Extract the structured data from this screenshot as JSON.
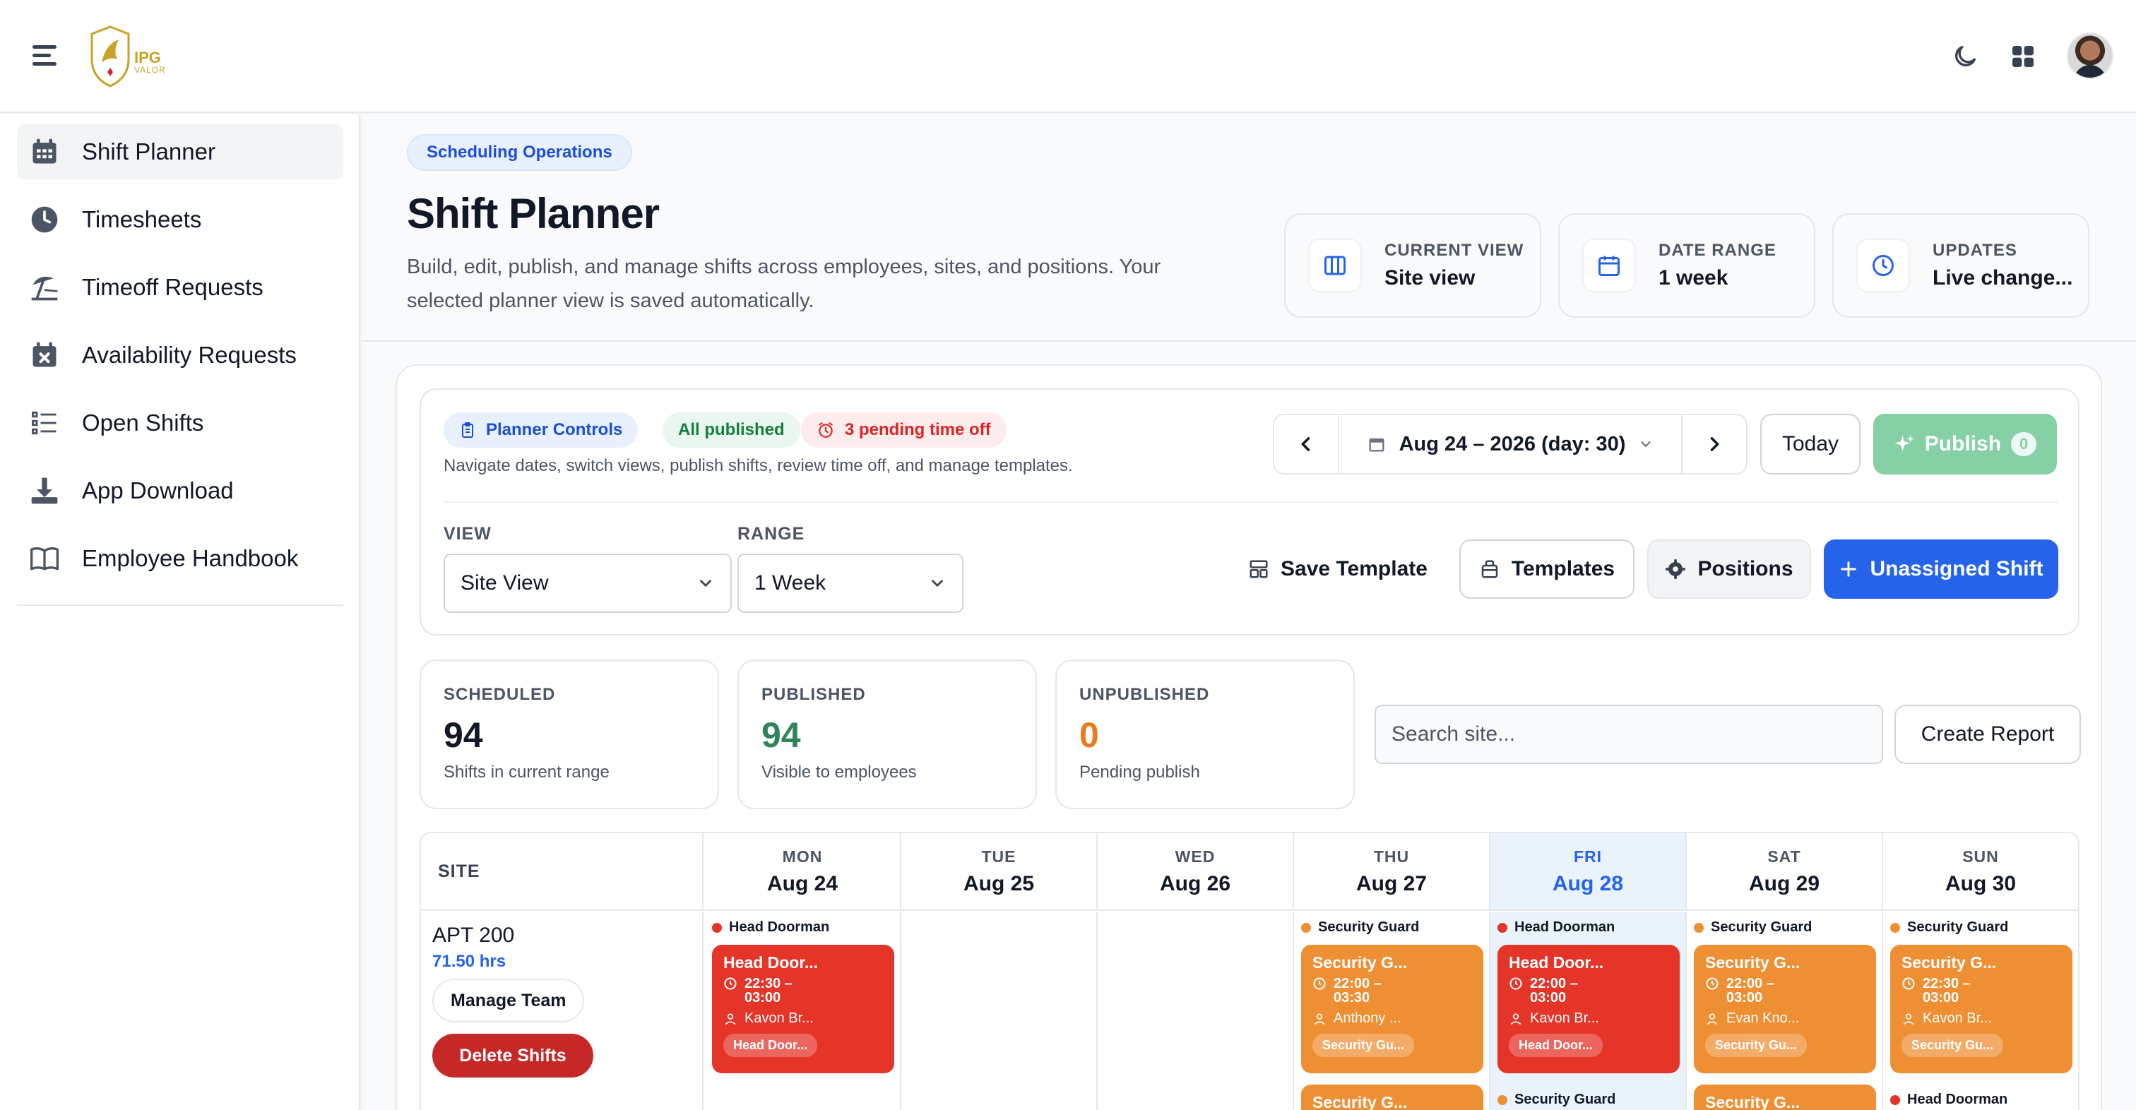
{
  "topbar": {
    "logo_text": "IPG",
    "logo_sub": "VALOR"
  },
  "sidebar": {
    "items": [
      {
        "label": "Shift Planner",
        "icon": "calendar-grid-icon",
        "active": true
      },
      {
        "label": "Timesheets",
        "icon": "clock-icon",
        "active": false
      },
      {
        "label": "Timeoff Requests",
        "icon": "beach-umbrella-icon",
        "active": false
      },
      {
        "label": "Availability Requests",
        "icon": "calendar-x-icon",
        "active": false
      },
      {
        "label": "Open Shifts",
        "icon": "list-icon",
        "active": false
      },
      {
        "label": "App Download",
        "icon": "download-icon",
        "active": false
      },
      {
        "label": "Employee Handbook",
        "icon": "book-icon",
        "active": false
      }
    ]
  },
  "header": {
    "badge": "Scheduling Operations",
    "title": "Shift Planner",
    "description": "Build, edit, publish, and manage shifts across employees, sites, and positions. Your selected planner view is saved automatically.",
    "stats": [
      {
        "key": "CURRENT VIEW",
        "value": "Site view",
        "icon": "columns-icon"
      },
      {
        "key": "DATE RANGE",
        "value": "1 week",
        "icon": "calendar-icon"
      },
      {
        "key": "UPDATES",
        "value": "Live change...",
        "icon": "clock-icon"
      }
    ]
  },
  "controls": {
    "badge_planner": "Planner Controls",
    "badge_published": "All published",
    "badge_pending": "3 pending time off",
    "hint": "Navigate dates, switch views, publish shifts, review time off, and manage templates.",
    "date_label": "Aug 24 – 2026 (day: 30)",
    "today_label": "Today",
    "publish_label": "Publish",
    "publish_count": "0",
    "view_label": "VIEW",
    "view_value": "Site View",
    "range_label": "RANGE",
    "range_value": "1 Week",
    "save_template": "Save Template",
    "templates": "Templates",
    "positions": "Positions",
    "unassigned_shift": "Unassigned Shift"
  },
  "summary": {
    "scheduled": {
      "key": "SCHEDULED",
      "value": "94",
      "sub": "Shifts in current range"
    },
    "published": {
      "key": "PUBLISHED",
      "value": "94",
      "sub": "Visible to employees"
    },
    "unpublished": {
      "key": "UNPUBLISHED",
      "value": "0",
      "sub": "Pending publish"
    },
    "search_placeholder": "Search site...",
    "create_report": "Create Report"
  },
  "calendar": {
    "site_header": "SITE",
    "days": [
      {
        "name": "MON",
        "date": "Aug 24"
      },
      {
        "name": "TUE",
        "date": "Aug 25"
      },
      {
        "name": "WED",
        "date": "Aug 26"
      },
      {
        "name": "THU",
        "date": "Aug 27"
      },
      {
        "name": "FRI",
        "date": "Aug 28",
        "today": true
      },
      {
        "name": "SAT",
        "date": "Aug 29"
      },
      {
        "name": "SUN",
        "date": "Aug 30"
      }
    ],
    "site": {
      "name": "APT 200",
      "hours": "71.50 hrs",
      "manage_team": "Manage Team",
      "delete_shifts": "Delete Shifts"
    },
    "shifts": {
      "mon": {
        "position": "Head Doorman",
        "title": "Head Door...",
        "time": "22:30 – 03:00",
        "employee": "Kavon Br...",
        "chip": "Head Door..."
      },
      "thu": {
        "position": "Security Guard",
        "title": "Security G...",
        "time": "22:00 – 03:30",
        "employee": "Anthony ...",
        "chip": "Security Gu...",
        "next_title": "Security G..."
      },
      "fri": {
        "position": "Head Doorman",
        "title": "Head Door...",
        "time": "22:00 – 03:00",
        "employee": "Kavon Br...",
        "chip": "Head Door...",
        "next_position": "Security Guard"
      },
      "sat": {
        "position": "Security Guard",
        "title": "Security G...",
        "time": "22:00 – 03:00",
        "employee": "Evan Kno...",
        "chip": "Security Gu...",
        "next_title": "Security G..."
      },
      "sun": {
        "position": "Security Guard",
        "title": "Security G...",
        "time": "22:30 – 03:00",
        "employee": "Kavon Br...",
        "chip": "Security Gu...",
        "next_position": "Head Doorman"
      }
    },
    "colors": {
      "red": "#e53428",
      "orange": "#ef8f34"
    }
  }
}
